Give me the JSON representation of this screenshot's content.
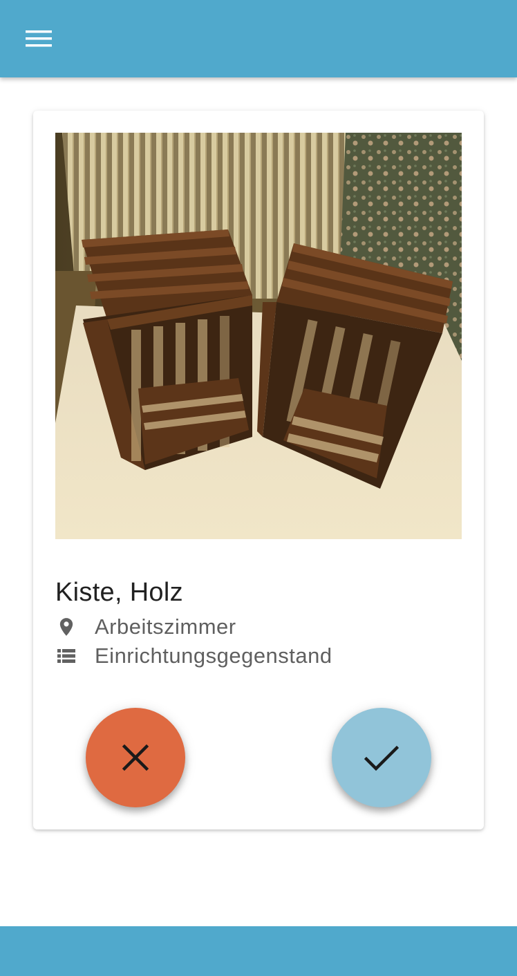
{
  "app_bar": {
    "menu_icon": "hamburger-menu-icon",
    "color": "#50a9cc"
  },
  "item": {
    "title": "Kiste, Holz",
    "location_icon": "location-pin-icon",
    "location": "Arbeitszimmer",
    "category_icon": "list-icon",
    "category": "Einrichtungsgegenstand",
    "photo_subject": "two-wooden-crates-photo"
  },
  "actions": {
    "reject_icon": "close-icon",
    "reject_color": "#df6a41",
    "accept_icon": "check-icon",
    "accept_color": "#91c4d9"
  },
  "bottom_bar": {
    "color": "#50a9cc"
  }
}
